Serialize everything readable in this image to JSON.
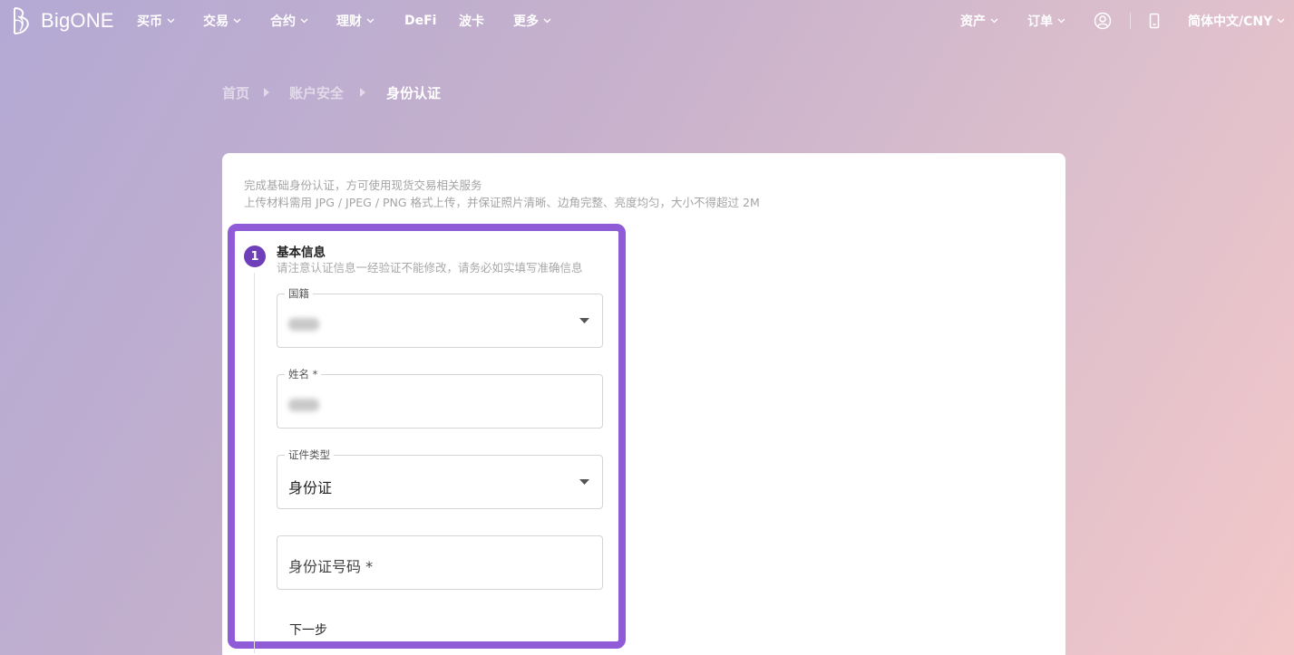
{
  "brand": {
    "name": "BigONE"
  },
  "nav": {
    "left": [
      {
        "label": "买币",
        "has_menu": true
      },
      {
        "label": "交易",
        "has_menu": true
      },
      {
        "label": "合约",
        "has_menu": true
      },
      {
        "label": "理财",
        "has_menu": true
      },
      {
        "label": "DeFi",
        "has_menu": false
      },
      {
        "label": "波卡",
        "has_menu": false
      },
      {
        "label": "更多",
        "has_menu": true
      }
    ],
    "right": {
      "assets": "资产",
      "orders": "订单",
      "account_icon": "user-circle-icon",
      "mobile_icon": "mobile-phone-icon",
      "language": "简体中文/CNY"
    }
  },
  "breadcrumb": {
    "items": [
      "首页",
      "账户安全",
      "身份认证"
    ]
  },
  "intro": {
    "line1": "完成基础身份认证，方可使用现货交易相关服务",
    "line2": "上传材料需用 JPG / JPEG / PNG 格式上传，并保证照片清晰、边角完整、亮度均匀，大小不得超过 2M"
  },
  "step": {
    "number": "1",
    "title": "基本信息",
    "subtitle": "请注意认证信息一经验证不能修改，请务必如实填写准确信息"
  },
  "form": {
    "nationality": {
      "label": "国籍"
    },
    "name": {
      "label": "姓名 *"
    },
    "id_type": {
      "label": "证件类型",
      "value": "身份证"
    },
    "id_number": {
      "placeholder": "身份证号码 *"
    },
    "next_label": "下一步"
  },
  "colors": {
    "highlight": "#8f5bd6",
    "step_badge": "#6e3fb8"
  }
}
